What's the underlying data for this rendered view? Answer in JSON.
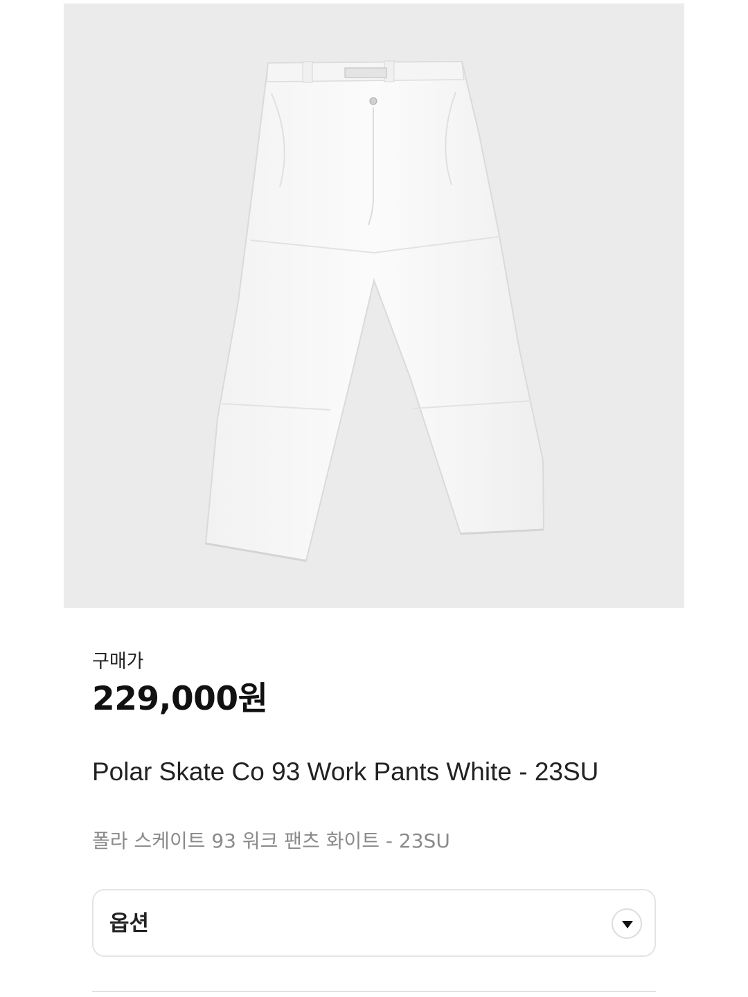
{
  "product": {
    "image_alt": "Polar Skate Co 93 Work Pants White",
    "price_label": "구매가",
    "price": "229,000원",
    "name_en": "Polar Skate Co 93 Work Pants White - 23SU",
    "name_ko": "폴라 스케이트 93 워크 팬츠 화이트 - 23SU"
  },
  "options": {
    "label": "옵션",
    "icon": "chevron-down-icon"
  },
  "colors": {
    "image_background": "#ebebeb",
    "pants": "#f7f7f7"
  }
}
